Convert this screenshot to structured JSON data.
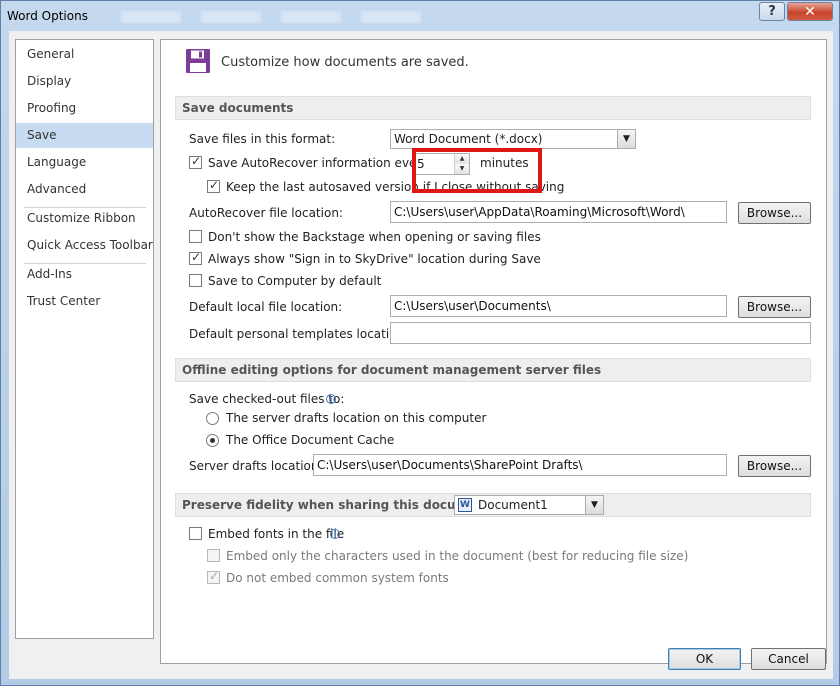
{
  "window": {
    "title": "Word Options",
    "help_label": "?",
    "close_label": "✕"
  },
  "sidebar": {
    "items": [
      {
        "label": "General"
      },
      {
        "label": "Display"
      },
      {
        "label": "Proofing"
      },
      {
        "label": "Save"
      },
      {
        "label": "Language"
      },
      {
        "label": "Advanced"
      },
      {
        "label": "Customize Ribbon"
      },
      {
        "label": "Quick Access Toolbar"
      },
      {
        "label": "Add-Ins"
      },
      {
        "label": "Trust Center"
      }
    ],
    "selected": "Save"
  },
  "header": {
    "icon": "save-floppy-icon",
    "text": "Customize how documents are saved."
  },
  "save_documents": {
    "title": "Save documents",
    "format_label": "Save files in this format:",
    "format_value": "Word Document (*.docx)",
    "autorecover_label": "Save AutoRecover information every",
    "autorecover_checked": true,
    "autorecover_minutes": "5",
    "minutes_label": "minutes",
    "keep_last_label": "Keep the last autosaved version if I close without saving",
    "keep_last_checked": true,
    "autorecover_location_label": "AutoRecover file location:",
    "autorecover_location_value": "C:\\Users\\user\\AppData\\Roaming\\Microsoft\\Word\\",
    "browse_label": "Browse...",
    "dont_show_backstage_label": "Don't show the Backstage when opening or saving files",
    "dont_show_backstage_checked": false,
    "always_show_signin_label": "Always show \"Sign in to SkyDrive\" location during Save",
    "always_show_signin_checked": true,
    "save_to_computer_label": "Save to Computer by default",
    "save_to_computer_checked": false,
    "default_local_label": "Default local file location:",
    "default_local_value": "C:\\Users\\user\\Documents\\",
    "templates_label": "Default personal templates location:",
    "templates_value": ""
  },
  "offline": {
    "title": "Offline editing options for document management server files",
    "checked_out_label": "Save checked-out files to:",
    "radio_server_drafts_label": "The server drafts location on this computer",
    "radio_office_cache_label": "The Office Document Cache",
    "selected_radio": "office_cache",
    "server_drafts_label": "Server drafts location:",
    "server_drafts_value": "C:\\Users\\user\\Documents\\SharePoint Drafts\\"
  },
  "fidelity": {
    "title": "Preserve fidelity when sharing this document:",
    "document_value": "Document1",
    "embed_fonts_label": "Embed fonts in the file",
    "embed_fonts_checked": false,
    "embed_only_used_label": "Embed only the characters used in the document (best for reducing file size)",
    "embed_only_used_checked": false,
    "no_common_fonts_label": "Do not embed common system fonts",
    "no_common_fonts_checked": true
  },
  "footer": {
    "ok_label": "OK",
    "cancel_label": "Cancel"
  },
  "colors": {
    "selection": "#c7dcf0",
    "highlight": "#e01616",
    "floppy": "#7d3c98"
  }
}
